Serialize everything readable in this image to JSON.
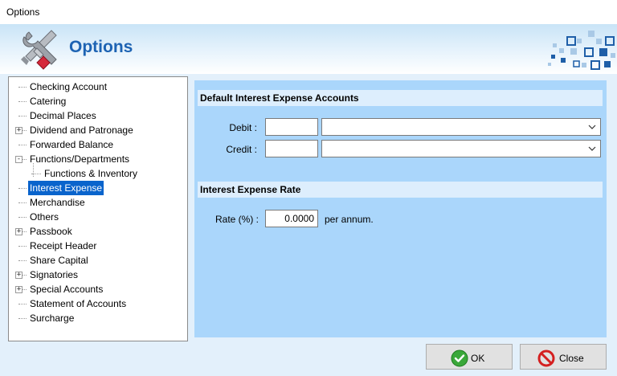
{
  "window": {
    "title": "Options"
  },
  "header": {
    "title": "Options",
    "icon": "tools-icon"
  },
  "tree": {
    "items": [
      {
        "label": "Checking Account",
        "expander": ""
      },
      {
        "label": "Catering",
        "expander": ""
      },
      {
        "label": "Decimal Places",
        "expander": ""
      },
      {
        "label": "Dividend and Patronage",
        "expander": "+"
      },
      {
        "label": "Forwarded Balance",
        "expander": ""
      },
      {
        "label": "Functions/Departments",
        "expander": "-"
      },
      {
        "label": "Functions & Inventory",
        "expander": ""
      },
      {
        "label": "Interest Expense",
        "expander": "",
        "selected": true
      },
      {
        "label": "Merchandise",
        "expander": ""
      },
      {
        "label": "Others",
        "expander": ""
      },
      {
        "label": "Passbook",
        "expander": "+"
      },
      {
        "label": "Receipt Header",
        "expander": ""
      },
      {
        "label": "Share Capital",
        "expander": ""
      },
      {
        "label": "Signatories",
        "expander": "+"
      },
      {
        "label": "Special Accounts",
        "expander": "+"
      },
      {
        "label": "Statement of Accounts",
        "expander": ""
      },
      {
        "label": "Surcharge",
        "expander": ""
      }
    ]
  },
  "panel": {
    "accounts_section": {
      "title": "Default Interest Expense Accounts",
      "debit_label": "Debit :",
      "debit_code": "",
      "debit_account": "",
      "credit_label": "Credit :",
      "credit_code": "",
      "credit_account": ""
    },
    "rate_section": {
      "title": "Interest Expense Rate",
      "rate_label": "Rate (%) :",
      "rate_value": "0.0000",
      "rate_suffix": "per annum."
    }
  },
  "buttons": {
    "ok_label": "OK",
    "close_label": "Close"
  },
  "colors": {
    "accent": "#1d63b3",
    "selection": "#0a64cc",
    "panel_bg": "#aad6fb",
    "section_bg": "#ddeefd",
    "ok_icon": "#3aa83a",
    "close_icon": "#d42020"
  }
}
